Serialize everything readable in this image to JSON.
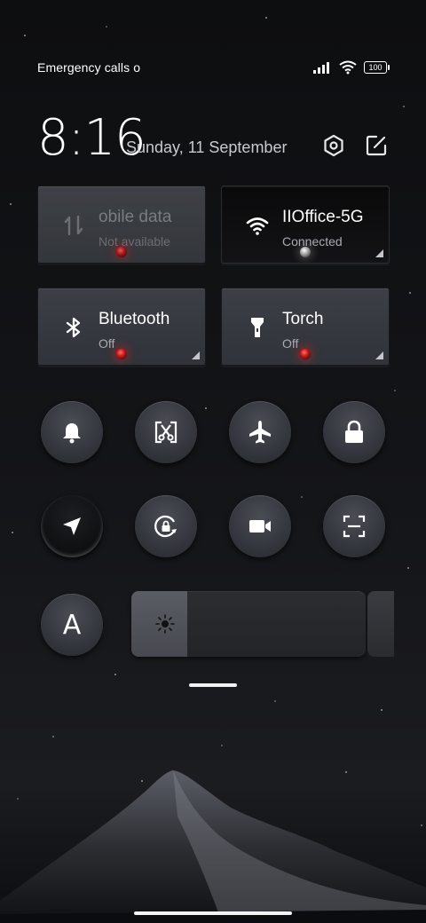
{
  "status_bar": {
    "carrier_text": "Emergency calls o",
    "battery": "100"
  },
  "header": {
    "time": "8:16",
    "date": "Sunday, 11 September",
    "settings_icon": "hexagon-settings-icon",
    "edit_icon": "edit-icon"
  },
  "tiles": [
    {
      "id": "mobile-data",
      "title": "obile data",
      "subtitle": "Not available",
      "icon": "mobile-data-icon",
      "state": "unavailable"
    },
    {
      "id": "wifi",
      "title": "IIOffice-5G",
      "subtitle": "Connected",
      "icon": "wifi-icon",
      "state": "on"
    },
    {
      "id": "bluetooth",
      "title": "Bluetooth",
      "subtitle": "Off",
      "icon": "bluetooth-icon",
      "state": "off"
    },
    {
      "id": "torch",
      "title": "Torch",
      "subtitle": "Off",
      "icon": "torch-icon",
      "state": "off"
    }
  ],
  "toggles_row1": [
    "bell-icon",
    "screenshot-scissors-icon",
    "airplane-icon",
    "lock-icon"
  ],
  "toggles_row2": [
    "location-icon",
    "rotation-lock-icon",
    "video-camera-icon",
    "scan-icon"
  ],
  "auto_brightness": {
    "letter": "A"
  },
  "brightness": {
    "level": 0.24,
    "icon": "sun-icon"
  },
  "colors": {
    "led_off": "#d01515",
    "led_on": "#ffffff",
    "tile_bg": "#34373d"
  }
}
